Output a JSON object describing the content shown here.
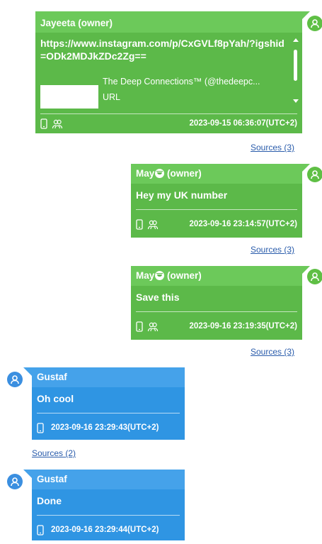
{
  "messages": [
    {
      "sender": "Jayeeta (owner)",
      "link": "https://www.instagram.com/p/CxGVLf8pYah/?igshid=ODk2MDJkZDc2Zg==",
      "preview_title": "The Deep Connections™ (@thedeepc...",
      "preview_url": "URL",
      "timestamp": "2023-09-15 06:36:07(UTC+2)",
      "sources": "Sources (3)"
    },
    {
      "sender_name": "May",
      "sender_suffix": "(owner)",
      "text": "Hey my UK number",
      "timestamp": "2023-09-16 23:14:57(UTC+2)",
      "sources": "Sources (3)"
    },
    {
      "sender_name": "May",
      "sender_suffix": "(owner)",
      "text": "Save this",
      "timestamp": "2023-09-16 23:19:35(UTC+2)",
      "sources": "Sources (3)"
    },
    {
      "sender": "Gustaf",
      "text": "Oh cool",
      "timestamp": "2023-09-16 23:29:43(UTC+2)",
      "sources": "Sources (2)"
    },
    {
      "sender": "Gustaf",
      "text": "Done",
      "timestamp": "2023-09-16 23:29:44(UTC+2)"
    }
  ],
  "colors": {
    "outgoing": "#5cb949",
    "incoming": "#2f95e3",
    "link": "#2a5cab"
  },
  "icons": [
    "user-avatar-icon",
    "phone-icon",
    "contacts-icon",
    "smiley-emoji-icon"
  ]
}
